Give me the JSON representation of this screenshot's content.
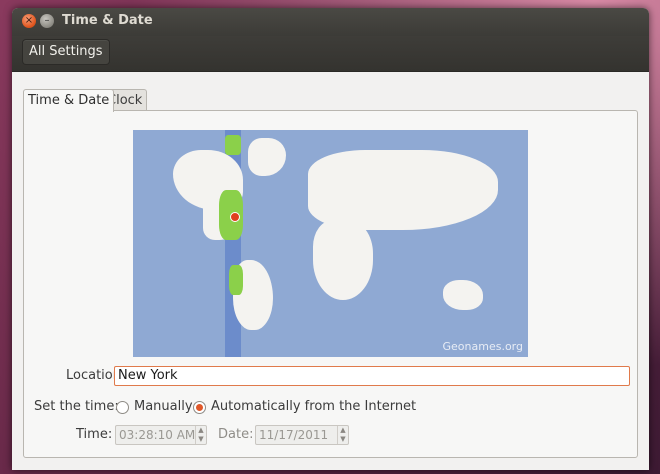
{
  "window": {
    "title": "Time & Date",
    "close_symbol": "×",
    "minimize_symbol": "–"
  },
  "toolbar": {
    "all_settings_label": "All Settings"
  },
  "tabs": [
    {
      "label": "Time & Date",
      "active": true
    },
    {
      "label": "Clock",
      "active": false
    }
  ],
  "map": {
    "attribution": "Geonames.org",
    "ocean_color": "#8fa9d3",
    "highlight_color": "#8bd04a",
    "pin_color": "#e0401f"
  },
  "location": {
    "label": "Location:",
    "value": "New York"
  },
  "set_time": {
    "label": "Set the time:",
    "options": [
      {
        "label": "Manually",
        "selected": false
      },
      {
        "label": "Automatically from the Internet",
        "selected": true
      }
    ]
  },
  "time": {
    "label": "Time:",
    "value": "03:28:10 AM"
  },
  "date": {
    "label": "Date:",
    "value": "11/17/2011"
  },
  "colors": {
    "accent": "#e0582a",
    "titlebar": "#3c3b37",
    "background": "#f2f1f0"
  }
}
